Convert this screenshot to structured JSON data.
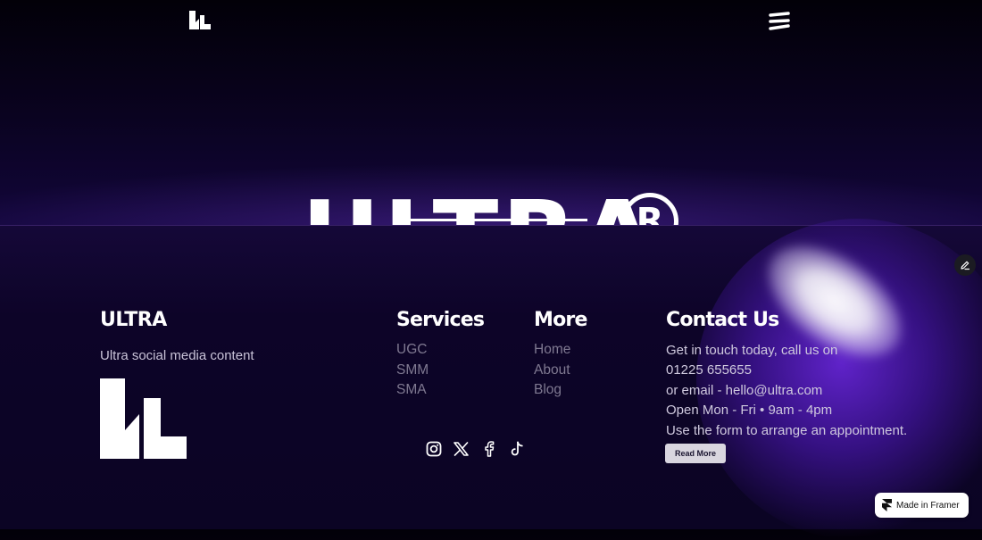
{
  "nav": {
    "logo_icon": "ultra-logo-icon",
    "menu_icon": "menu-icon"
  },
  "hero": {
    "word": "ULTRA",
    "registered": "R"
  },
  "footer": {
    "brand": {
      "title": "ULTRA",
      "tagline": "Ultra social media content",
      "logo_icon": "ultra-logo-icon"
    },
    "services": {
      "heading": "Services",
      "links": [
        "UGC",
        "SMM",
        "SMA"
      ]
    },
    "more": {
      "heading": "More",
      "links": [
        "Home",
        "About",
        "Blog"
      ]
    },
    "contact": {
      "heading": "Contact Us",
      "lines": [
        "Get in touch today, call us on",
        "01225 655655",
        "or email - hello@ultra.com",
        "Open Mon - Fri • 9am - 4pm",
        "Use the form to arrange an appointment."
      ],
      "button_label": "Read More"
    },
    "socials": [
      "instagram-icon",
      "x-icon",
      "facebook-icon",
      "tiktok-icon"
    ]
  },
  "badge": {
    "label": "Made in Framer",
    "icon": "framer-icon"
  },
  "edit_icon": "pencil-icon",
  "colors": {
    "background": "#0c0428",
    "accent_purple": "#6e28e6",
    "link_muted": "#7f7991",
    "text_light": "#cfc9de"
  }
}
